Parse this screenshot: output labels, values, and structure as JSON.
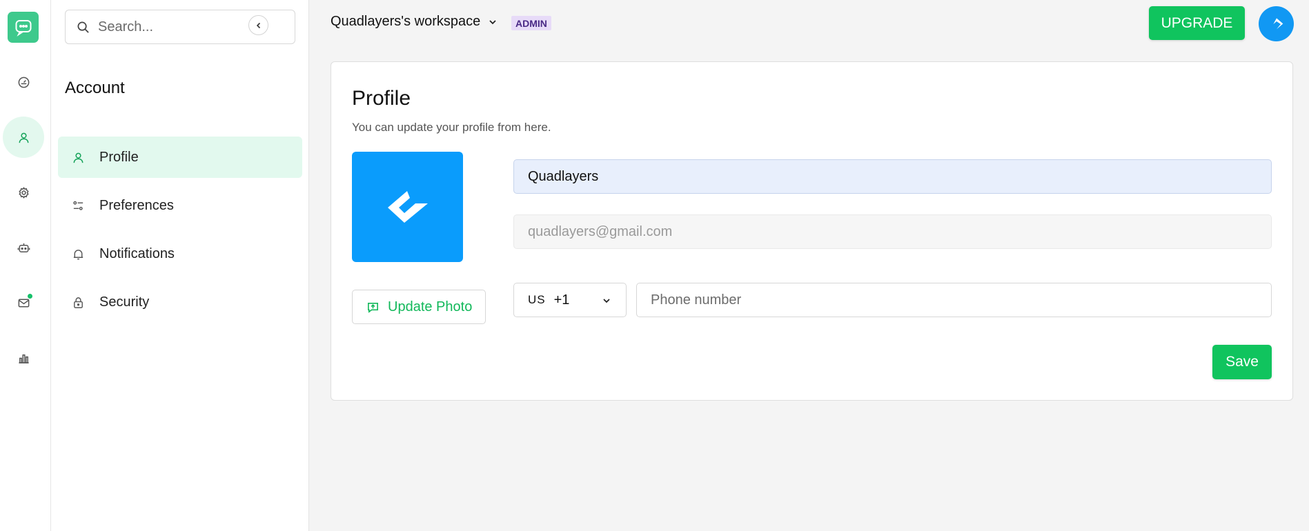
{
  "rail": {
    "items": [
      {
        "icon": "dashboard-icon"
      },
      {
        "icon": "user-icon",
        "active": true
      },
      {
        "icon": "gear-icon"
      },
      {
        "icon": "bot-icon"
      },
      {
        "icon": "mail-icon",
        "has_dot": true
      },
      {
        "icon": "chart-icon"
      }
    ]
  },
  "sidebar": {
    "search_placeholder": "Search...",
    "title": "Account",
    "items": [
      {
        "label": "Profile",
        "icon": "user-icon",
        "active": true
      },
      {
        "label": "Preferences",
        "icon": "sliders-icon"
      },
      {
        "label": "Notifications",
        "icon": "bell-icon"
      },
      {
        "label": "Security",
        "icon": "lock-icon"
      }
    ]
  },
  "header": {
    "workspace": "Quadlayers's workspace",
    "role_badge": "ADMIN",
    "upgrade_label": "UPGRADE"
  },
  "profile": {
    "title": "Profile",
    "subtitle": "You can update your profile from here.",
    "update_photo_label": "Update Photo",
    "name_value": "Quadlayers",
    "email_value": "quadlayers@gmail.com",
    "country_code": "US",
    "dial_code": "+1",
    "phone_placeholder": "Phone number",
    "save_label": "Save"
  },
  "colors": {
    "accent": "#10c45e",
    "brand_blue": "#0a9cfc",
    "active_bg": "#e2f9ee",
    "badge_bg": "#e7dbf8"
  }
}
